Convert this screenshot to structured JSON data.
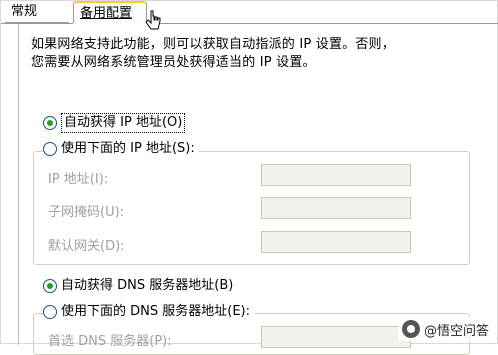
{
  "tabs": [
    {
      "label": "常规",
      "active": false
    },
    {
      "label": "备用配置",
      "active": true
    }
  ],
  "description": {
    "line1": "如果网络支持此功能，则可以获取自动指派的 IP 设置。否则，",
    "line2": "您需要从网络系统管理员处获得适当的 IP 设置。"
  },
  "ip_options": {
    "auto": {
      "label": "自动获得 IP 地址(O)",
      "checked": true
    },
    "manual": {
      "label": "使用下面的 IP 地址(S):",
      "checked": false
    }
  },
  "ip_fields": [
    {
      "label": "IP 地址(I):",
      "value": ""
    },
    {
      "label": "子网掩码(U):",
      "value": ""
    },
    {
      "label": "默认网关(D):",
      "value": ""
    }
  ],
  "dns_options": {
    "auto": {
      "label": "自动获得 DNS 服务器地址(B)",
      "checked": true
    },
    "manual": {
      "label": "使用下面的 DNS 服务器地址(E):",
      "checked": false
    }
  },
  "dns_fields": [
    {
      "label": "首选 DNS 服务器(P):",
      "value": ""
    }
  ],
  "watermark": {
    "text": "@悟空问答",
    "icon": "wukong-logo-icon"
  },
  "colors": {
    "tab_highlight": "#ffc83c",
    "radio_dot": "#21a121",
    "disabled_text": "#a0a0a0"
  }
}
